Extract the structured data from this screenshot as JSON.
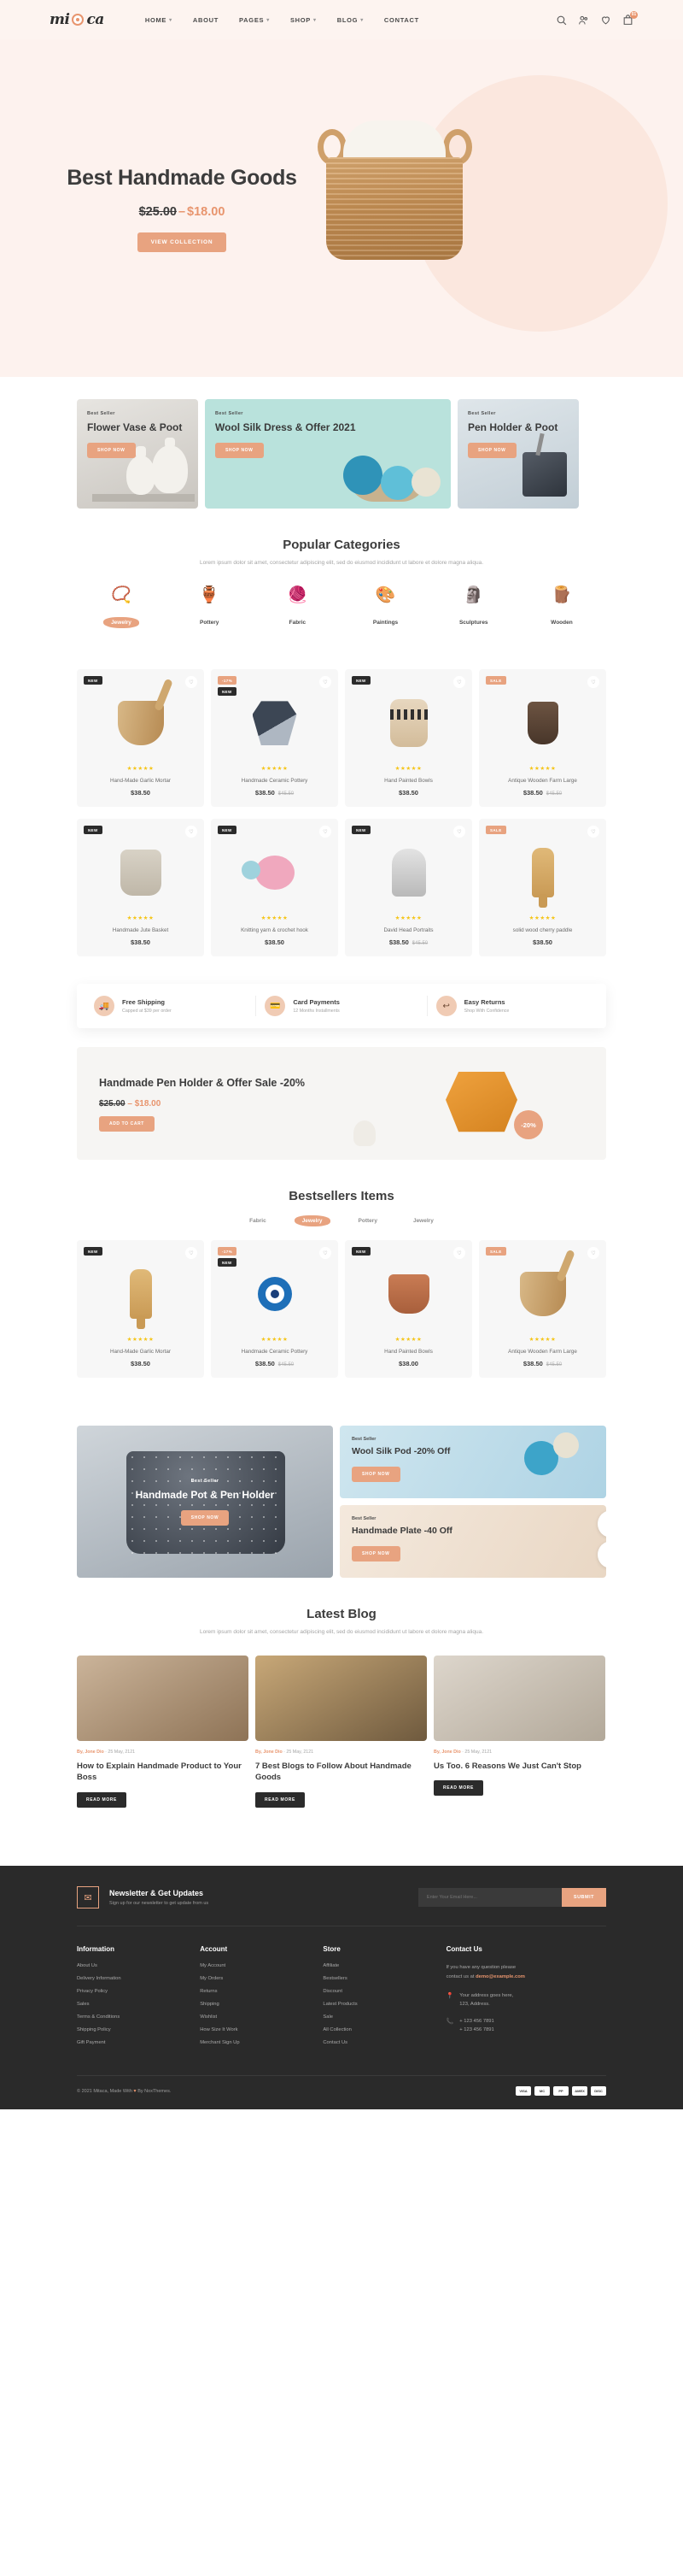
{
  "header": {
    "logo_text_left": "mi",
    "logo_text_right": "ca",
    "nav": [
      {
        "label": "HOME",
        "caret": "▾"
      },
      {
        "label": "ABOUT",
        "caret": ""
      },
      {
        "label": "PAGES",
        "caret": "▾"
      },
      {
        "label": "SHOP",
        "caret": "▾"
      },
      {
        "label": "BLOG",
        "caret": "▾"
      },
      {
        "label": "CONTACT",
        "caret": ""
      }
    ],
    "icons": [
      "search-icon",
      "account-icon",
      "wishlist-icon",
      "cart-icon"
    ],
    "cart_count": "01"
  },
  "hero": {
    "title": "Best Handmade Goods",
    "old_price": "$25.00",
    "dash": "–",
    "new_price": "$18.00",
    "cta": "VIEW COLLECTION"
  },
  "banner_cards": [
    {
      "tag": "Best Seller",
      "title": "Flower Vase & Poot",
      "cta": "SHOP NOW"
    },
    {
      "tag": "Best Seller",
      "title": "Wool Silk Dress & Offer 2021",
      "cta": "SHOP NOW"
    },
    {
      "tag": "Best Seller",
      "title": "Pen Holder & Poot",
      "cta": "SHOP NOW"
    }
  ],
  "categories_section": {
    "title": "Popular Categories",
    "subtitle": "Lorem ipsum dolor sit amet, consectetur adipiscing elit, sed do eiusmod incididunt ut labore et dolore magna aliqua.",
    "items": [
      {
        "label": "Jewelry",
        "icon": "📿",
        "active": true
      },
      {
        "label": "Pottery",
        "icon": "🏺",
        "active": false
      },
      {
        "label": "Fabric",
        "icon": "🧶",
        "active": false
      },
      {
        "label": "Paintings",
        "icon": "🎨",
        "active": false
      },
      {
        "label": "Sculptures",
        "icon": "🗿",
        "active": false
      },
      {
        "label": "Wooden",
        "icon": "🪵",
        "active": false
      }
    ]
  },
  "products_row1": [
    {
      "name": "Hand-Made Garlic Mortar",
      "price": "$38.50",
      "old_price": "",
      "stars": "★★★★★",
      "badges": [
        {
          "text": "NEW",
          "kind": "new"
        }
      ],
      "art": "mortar"
    },
    {
      "name": "Handmade Ceramic Pottery",
      "price": "$38.50",
      "old_price": "$45.50",
      "stars": "★★★★★",
      "badges": [
        {
          "text": "-17%",
          "kind": "sale"
        },
        {
          "text": "NEW",
          "kind": "new"
        }
      ],
      "art": "geopot"
    },
    {
      "name": "Hand Painted Bowls",
      "price": "$38.50",
      "old_price": "",
      "stars": "★★★★★",
      "badges": [
        {
          "text": "NEW",
          "kind": "new"
        }
      ],
      "art": "jar"
    },
    {
      "name": "Antique Wooden Farm Large",
      "price": "$38.50",
      "old_price": "$45.50",
      "stars": "★★★★★",
      "badges": [
        {
          "text": "SALE",
          "kind": "sale"
        }
      ],
      "art": "cup"
    }
  ],
  "products_row2": [
    {
      "name": "Handmade Jute Basket",
      "price": "$38.50",
      "old_price": "",
      "stars": "★★★★★",
      "badges": [
        {
          "text": "NEW",
          "kind": "new"
        }
      ],
      "art": "jute"
    },
    {
      "name": "Knitting yarn & crochet hook",
      "price": "$38.50",
      "old_price": "",
      "stars": "★★★★★",
      "badges": [
        {
          "text": "NEW",
          "kind": "new"
        }
      ],
      "art": "ball"
    },
    {
      "name": "David Head Portraits",
      "price": "$38.50",
      "old_price": "$45.50",
      "stars": "★★★★★",
      "badges": [
        {
          "text": "NEW",
          "kind": "new"
        }
      ],
      "art": "bust"
    },
    {
      "name": "solid wood cherry paddle",
      "price": "$38.50",
      "old_price": "",
      "stars": "★★★★★",
      "badges": [
        {
          "text": "SALE",
          "kind": "sale"
        }
      ],
      "art": "paddle"
    }
  ],
  "features": [
    {
      "icon": "🚚",
      "title": "Free Shipping",
      "subtitle": "Capped at $39 per order",
      "icon_name": "truck-icon"
    },
    {
      "icon": "💳",
      "title": "Card Payments",
      "subtitle": "12 Months Installments",
      "icon_name": "card-icon"
    },
    {
      "icon": "↩",
      "title": "Easy Returns",
      "subtitle": "Shop With Confidence",
      "icon_name": "return-icon"
    }
  ],
  "promo": {
    "title": "Handmade Pen Holder & Offer Sale -20%",
    "old_price": "$25.00",
    "dash": "–",
    "new_price": "$18.00",
    "cta": "ADD TO CART",
    "discount": "-20%"
  },
  "bestsellers": {
    "title": "Bestsellers Items",
    "tabs": [
      {
        "label": "Fabric",
        "active": false
      },
      {
        "label": "Jewelry",
        "active": true
      },
      {
        "label": "Pottery",
        "active": false
      },
      {
        "label": "Jewelry",
        "active": false
      }
    ],
    "products": [
      {
        "name": "Hand-Made Garlic Mortar",
        "price": "$38.50",
        "old_price": "",
        "stars": "★★★★★",
        "badges": [
          {
            "text": "NEW",
            "kind": "new"
          }
        ],
        "art": "paddle"
      },
      {
        "name": "Handmade Ceramic Pottery",
        "price": "$38.50",
        "old_price": "$45.50",
        "stars": "★★★★★",
        "badges": [
          {
            "text": "-17%",
            "kind": "sale"
          },
          {
            "text": "NEW",
            "kind": "new"
          }
        ],
        "art": "eye"
      },
      {
        "name": "Hand Painted Bowls",
        "price": "$38.00",
        "old_price": "",
        "stars": "★★★★★",
        "badges": [
          {
            "text": "NEW",
            "kind": "new"
          }
        ],
        "art": "terra"
      },
      {
        "name": "Antique Wooden Farm Large",
        "price": "$38.50",
        "old_price": "$45.50",
        "stars": "★★★★★",
        "badges": [
          {
            "text": "SALE",
            "kind": "sale"
          }
        ],
        "art": "mortar"
      }
    ]
  },
  "banners2": {
    "big": {
      "tag": "Best Seller",
      "title": "Handmade Pot & Pen Holder",
      "cta": "SHOP NOW"
    },
    "right_top": {
      "tag": "Best Seller",
      "title": "Wool Silk Pod -20% Off",
      "cta": "SHOP NOW"
    },
    "right_bottom": {
      "tag": "Best Seller",
      "title": "Handmade Plate -40 Off",
      "cta": "SHOP NOW"
    }
  },
  "blog": {
    "title": "Latest Blog",
    "subtitle": "Lorem ipsum dolor sit amet, consectetur adipiscing elit, sed do eiusmod incididunt ut labore et dolore magna aliqua.",
    "posts": [
      {
        "author": "By, Jone Dio",
        "date": "25 May, 2121",
        "title": "How to Explain Handmade Product to Your Boss",
        "cta": "READ MORE"
      },
      {
        "author": "By, Jone Dio",
        "date": "25 May, 2121",
        "title": "7 Best Blogs to Follow About Handmade Goods",
        "cta": "READ MORE"
      },
      {
        "author": "By, Jone Dio",
        "date": "25 May, 2121",
        "title": "Us Too. 6 Reasons We Just Can't Stop",
        "cta": "READ MORE"
      }
    ]
  },
  "footer": {
    "newsletter": {
      "icon": "✉",
      "title": "Newsletter & Get Updates",
      "subtitle": "Sign up for our newsletter to get update from us",
      "placeholder": "Enter Your Email Here...",
      "button": "SUBMIT"
    },
    "columns": [
      {
        "heading": "Information",
        "links": [
          "About Us",
          "Delivery Information",
          "Privacy Policy",
          "Sales",
          "Terms & Conditions",
          "Shipping Policy",
          "Gift Payment"
        ]
      },
      {
        "heading": "Account",
        "links": [
          "My Account",
          "My Orders",
          "Returns",
          "Shipping",
          "Wishlist",
          "How Size It Work",
          "Merchant Sign Up"
        ]
      },
      {
        "heading": "Store",
        "links": [
          "Affiliate",
          "Bestsellers",
          "Discount",
          "Latest Products",
          "Sale",
          "All Collection",
          "Contact Us"
        ]
      }
    ],
    "contact": {
      "heading": "Contact Us",
      "note_pre": "If you have any question please",
      "note_post": "contact us at",
      "email": "demo@example.com",
      "address_line1": "Your address goes here,",
      "address_line2": "123, Address.",
      "phone1": "+ 123 456 7891",
      "phone2": "+ 123 456 7891",
      "pin_icon": "📍",
      "phone_icon": "📞"
    },
    "copyright_pre": "© 2021 Mitaca, Made With",
    "copyright_heart": "♥",
    "copyright_post": "By NoxThemes.",
    "payments": [
      "VISA",
      "MC",
      "PP",
      "AMEX",
      "DISC"
    ]
  }
}
